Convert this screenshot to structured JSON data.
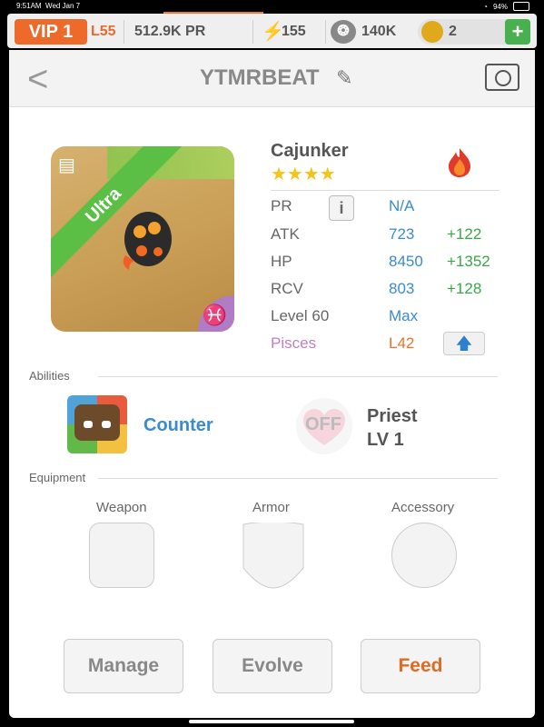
{
  "status_bar": {
    "time": "9:51AM",
    "date": "Wed Jan 7",
    "battery": "94%"
  },
  "top_bar": {
    "vip": "VIP 1",
    "level": "L55",
    "pr": "512.9K PR",
    "energy_value": "155",
    "paw_value": "140K",
    "coin_value": "2",
    "plus_label": "+"
  },
  "header": {
    "title": "YTMRBEAT"
  },
  "monster": {
    "rarity_label": "Ultra",
    "name": "Cajunker",
    "stars": "★★★★",
    "stats": [
      {
        "label": "PR",
        "value": "N/A",
        "bonus": ""
      },
      {
        "label": "ATK",
        "value": "723",
        "bonus": "+122"
      },
      {
        "label": "HP",
        "value": "8450",
        "bonus": "+1352"
      },
      {
        "label": "RCV",
        "value": "803",
        "bonus": "+128"
      },
      {
        "label": "Level 60",
        "value": "Max",
        "bonus": ""
      },
      {
        "label": "Pisces",
        "value": "L42",
        "bonus": ""
      }
    ]
  },
  "abilities": {
    "section_label": "Abilities",
    "ability_name": "Counter",
    "off_label": "OFF",
    "class_name": "Priest",
    "class_level": "LV 1"
  },
  "equipment": {
    "section_label": "Equipment",
    "slots": [
      "Weapon",
      "Armor",
      "Accessory"
    ]
  },
  "buttons": {
    "manage": "Manage",
    "evolve": "Evolve",
    "feed": "Feed"
  },
  "colors": {
    "accent_orange": "#ee6a2a",
    "stat_blue": "#3a8bd0",
    "bonus_green": "#39a745",
    "pisces_purple": "#c57ec6"
  }
}
